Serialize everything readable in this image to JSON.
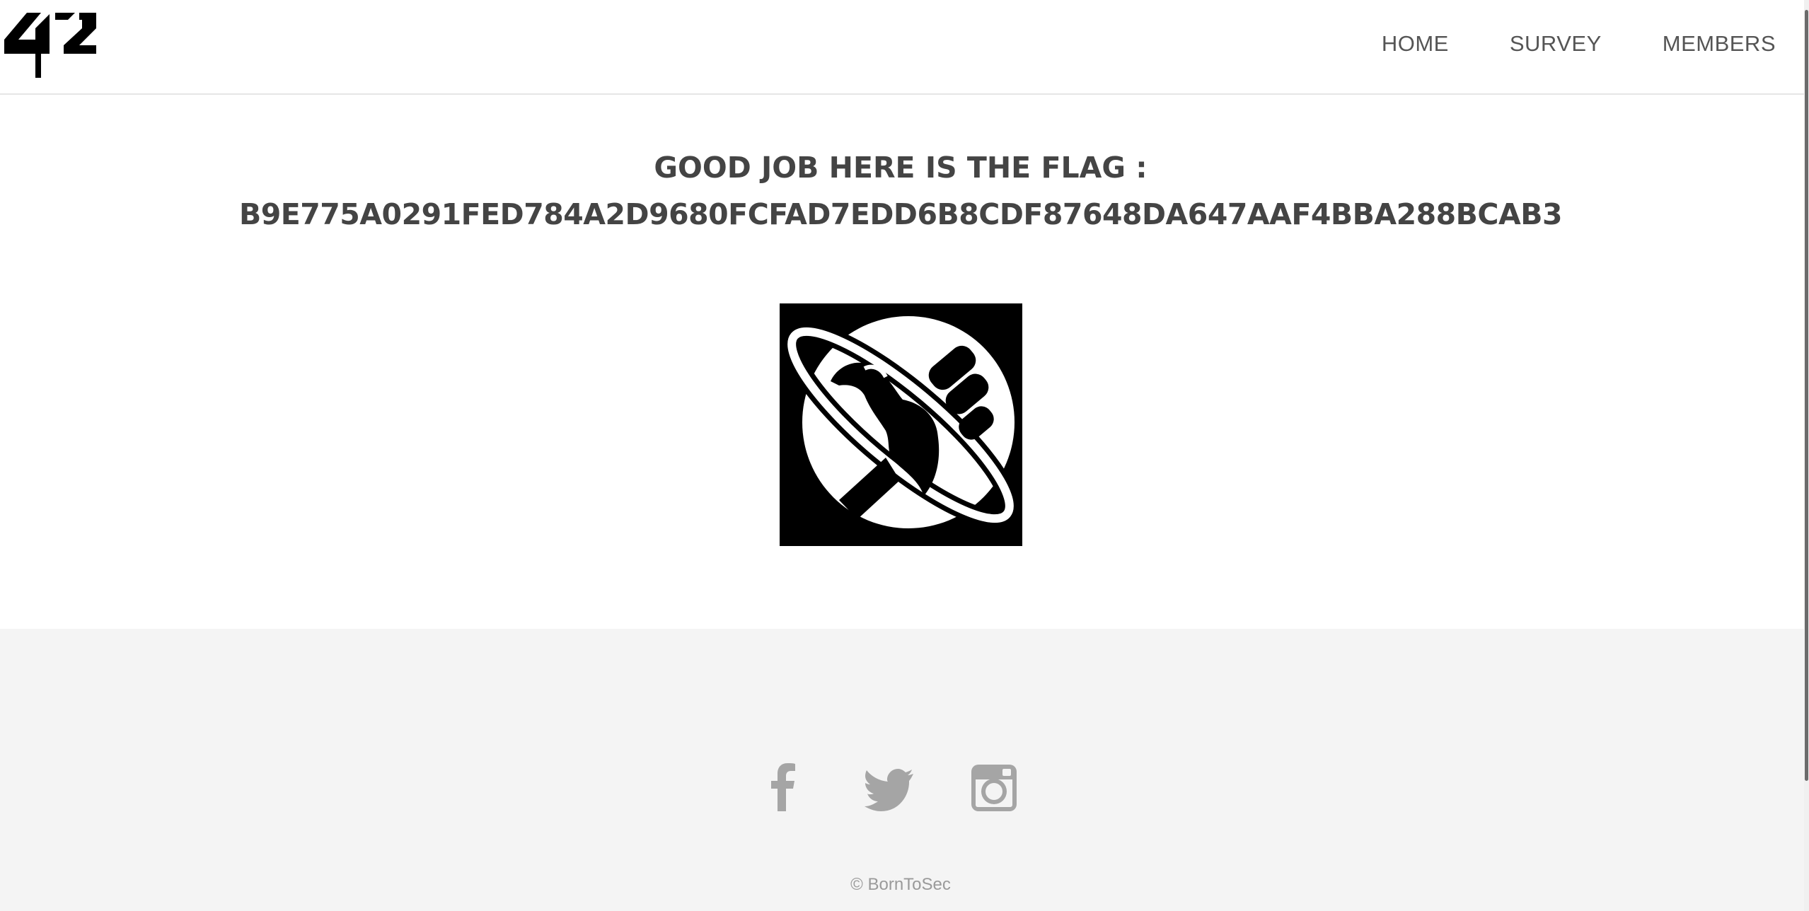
{
  "header": {
    "logo": "42",
    "nav": [
      {
        "label": "HOME"
      },
      {
        "label": "SURVEY"
      },
      {
        "label": "MEMBERS"
      }
    ]
  },
  "main": {
    "heading_line1": "GOOD JOB HERE IS THE FLAG :",
    "flag": "B9E775A0291FED784A2D9680FCFAD7EDD6B8CDF87648DA647AAF4BBA288BCAB3",
    "badge_icon": "thumbs-up-planet-icon"
  },
  "footer": {
    "social": [
      {
        "icon": "facebook-icon"
      },
      {
        "icon": "twitter-icon"
      },
      {
        "icon": "instagram-icon"
      }
    ],
    "copyright": "© BornToSec"
  },
  "colors": {
    "text": "#444444",
    "nav_text": "#555555",
    "footer_bg": "#f4f4f4",
    "social_icon": "#a5a5a5",
    "copyright": "#9a9a9a"
  }
}
